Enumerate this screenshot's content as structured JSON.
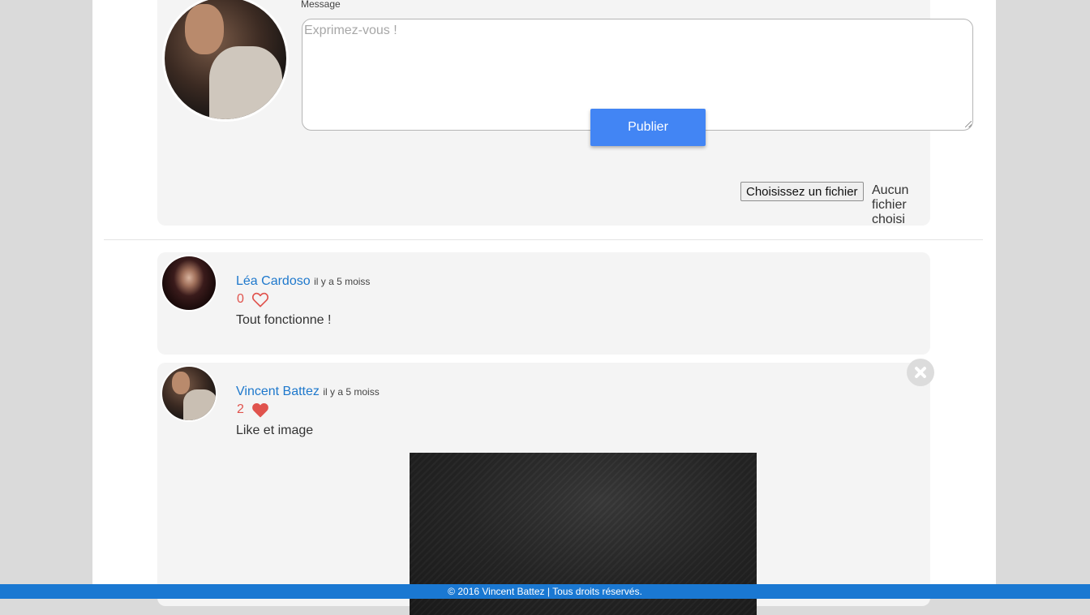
{
  "compose": {
    "label": "Message",
    "placeholder": "Exprimez-vous !",
    "publish_label": "Publier",
    "file_button_label": "Choisissez un fichier",
    "file_status": "Aucun fichier choisi"
  },
  "posts": [
    {
      "author": "Léa Cardoso",
      "time": "il y a 5 moiss",
      "likes": "0",
      "liked": false,
      "text": "Tout fonctionne !",
      "icon": "heart-outline-icon"
    },
    {
      "author": "Vincent Battez",
      "time": "il y a 5 moiss",
      "likes": "2",
      "liked": true,
      "text": "Like et image",
      "icon": "heart-filled-icon",
      "delete_icon": "close-icon"
    }
  ],
  "footer": {
    "text": "© 2016 Vincent Battez | Tous droits réservés."
  },
  "colors": {
    "accent": "#4285f4",
    "link": "#1e78cc",
    "like": "#e0534d",
    "footer": "#1a78d2"
  }
}
